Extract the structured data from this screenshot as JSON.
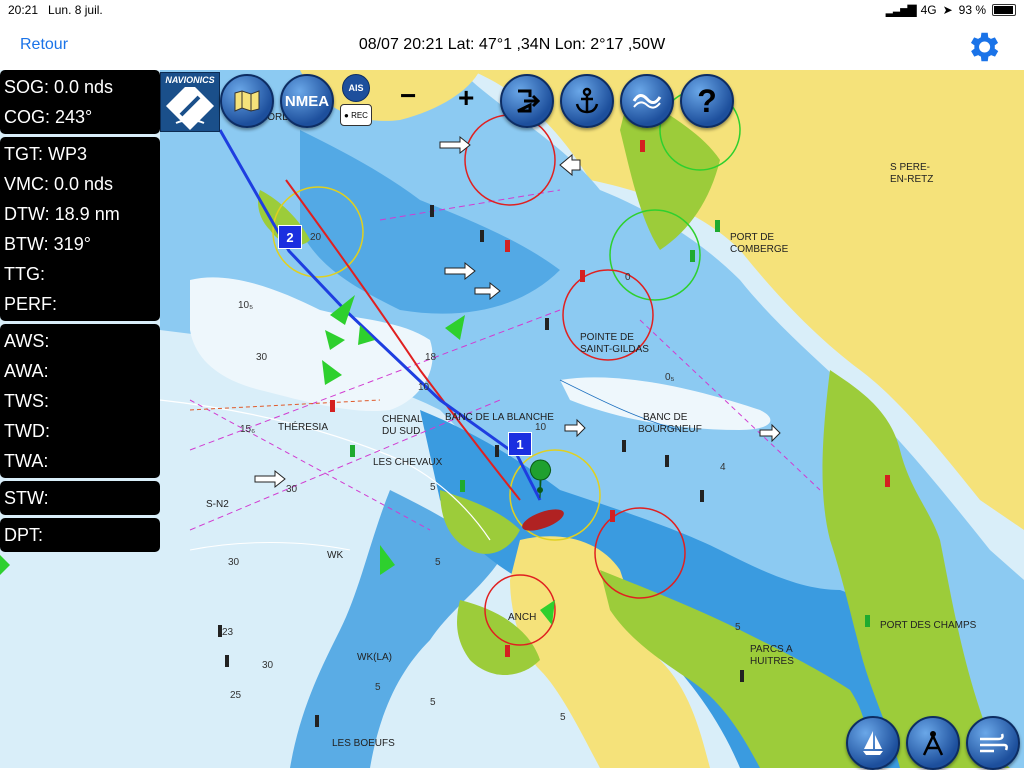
{
  "status_bar": {
    "time": "20:21",
    "date": "Lun. 8 juil.",
    "network": "4G",
    "battery": "93 %",
    "battery_level": 0.93
  },
  "nav_bar": {
    "back_label": "Retour",
    "title": "08/07 20:21  Lat: 47°1 ,34N Lon: 2°17 ,50W"
  },
  "instruments": {
    "group1": [
      {
        "label": "SOG: 0.0 nds"
      },
      {
        "label": "COG: 243°"
      }
    ],
    "group2": [
      {
        "label": "TGT: WP3"
      },
      {
        "label": "VMC: 0.0 nds"
      },
      {
        "label": "DTW: 18.9 nm"
      },
      {
        "label": "BTW: 319°"
      },
      {
        "label": "TTG:"
      },
      {
        "label": "PERF:"
      }
    ],
    "group3": [
      {
        "label": "AWS:"
      },
      {
        "label": "AWA:"
      },
      {
        "label": "TWS:"
      },
      {
        "label": "TWD:"
      },
      {
        "label": "TWA:"
      }
    ],
    "group4": [
      {
        "label": "STW:"
      }
    ],
    "group5": [
      {
        "label": "DPT:"
      }
    ]
  },
  "toolbar": {
    "logo": "NAVIONICS",
    "nmea_label": "NMEA",
    "ais_label": "AIS",
    "rec_label": "● REC",
    "zoom_out": "−",
    "zoom_in": "+",
    "help_label": "?"
  },
  "waypoints": [
    {
      "label": "1"
    },
    {
      "label": "2"
    }
  ],
  "map_labels": {
    "pere": "S PERE-",
    "pere2": "EN-RETZ",
    "comberge": "PORT DE",
    "comberge2": "COMBERGE",
    "gildas": "POINTE DE",
    "gildas2": "SAINT-GILDAS",
    "blanche": "BANC DE LA BLANCHE",
    "bourgneuf": "BANC DE",
    "bourgneuf2": "BOURGNEUF",
    "theresia": "THÉRESIA",
    "chenal": "CHENAL",
    "chenal2": "DU SUD",
    "chevaux": "LES CHEVAUX",
    "sn2": "S-N2",
    "wk": "WK",
    "wkla": "WK(LA)",
    "boeufs": "LES BOEUFS",
    "champs": "PORT DES CHAMPS",
    "parcs": "PARCS A",
    "parcs2": "HUITRES",
    "anch": "ANCH",
    "nord": "NORD"
  },
  "depths": [
    "30",
    "10₅",
    "15₆",
    "30",
    "30",
    "23",
    "30",
    "5",
    "10",
    "18",
    "5",
    "5",
    "5",
    "5",
    "0",
    "0₅",
    "10",
    "5",
    "20",
    "25",
    "4"
  ],
  "colors": {
    "land": "#f5e27a",
    "shallow": "#3a9be0",
    "mid": "#8ccaf2",
    "deep": "#d9eef9",
    "drying": "#9ccc3a",
    "route": "#1e3ee0",
    "course": "#e02020",
    "accent": "#1a73e8"
  }
}
